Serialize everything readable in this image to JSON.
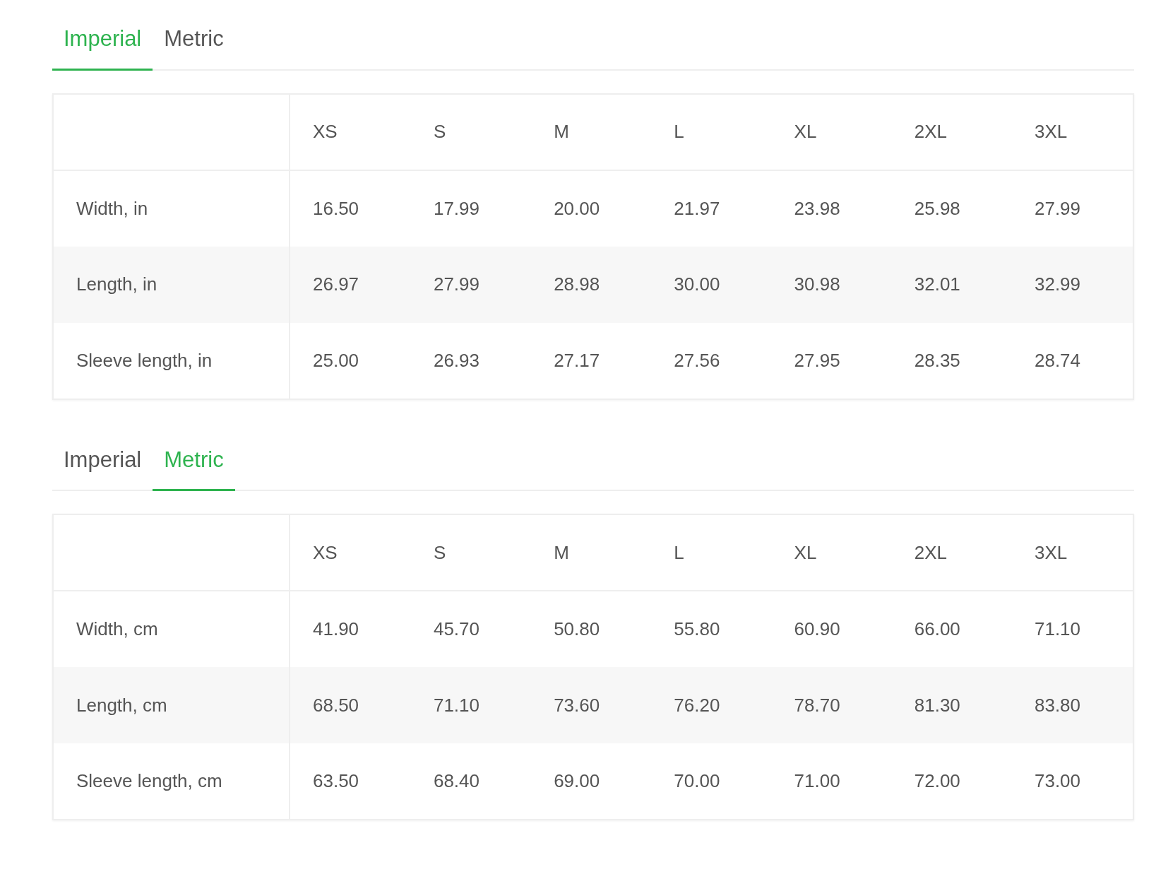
{
  "sections": [
    {
      "tabs": [
        {
          "label": "Imperial",
          "selected": true
        },
        {
          "label": "Metric",
          "selected": false
        }
      ],
      "table": {
        "columns": [
          "XS",
          "S",
          "M",
          "L",
          "XL",
          "2XL",
          "3XL"
        ],
        "rows": [
          {
            "label": "Width, in",
            "cells": [
              "16.50",
              "17.99",
              "20.00",
              "21.97",
              "23.98",
              "25.98",
              "27.99"
            ]
          },
          {
            "label": "Length, in",
            "cells": [
              "26.97",
              "27.99",
              "28.98",
              "30.00",
              "30.98",
              "32.01",
              "32.99"
            ]
          },
          {
            "label": "Sleeve length, in",
            "cells": [
              "25.00",
              "26.93",
              "27.17",
              "27.56",
              "27.95",
              "28.35",
              "28.74"
            ]
          }
        ]
      }
    },
    {
      "tabs": [
        {
          "label": "Imperial",
          "selected": false
        },
        {
          "label": "Metric",
          "selected": true
        }
      ],
      "table": {
        "columns": [
          "XS",
          "S",
          "M",
          "L",
          "XL",
          "2XL",
          "3XL"
        ],
        "rows": [
          {
            "label": "Width, cm",
            "cells": [
              "41.90",
              "45.70",
              "50.80",
              "55.80",
              "60.90",
              "66.00",
              "71.10"
            ]
          },
          {
            "label": "Length, cm",
            "cells": [
              "68.50",
              "71.10",
              "73.60",
              "76.20",
              "78.70",
              "81.30",
              "83.80"
            ]
          },
          {
            "label": "Sleeve length, cm",
            "cells": [
              "63.50",
              "68.40",
              "69.00",
              "70.00",
              "71.00",
              "72.00",
              "73.00"
            ]
          }
        ]
      }
    }
  ]
}
